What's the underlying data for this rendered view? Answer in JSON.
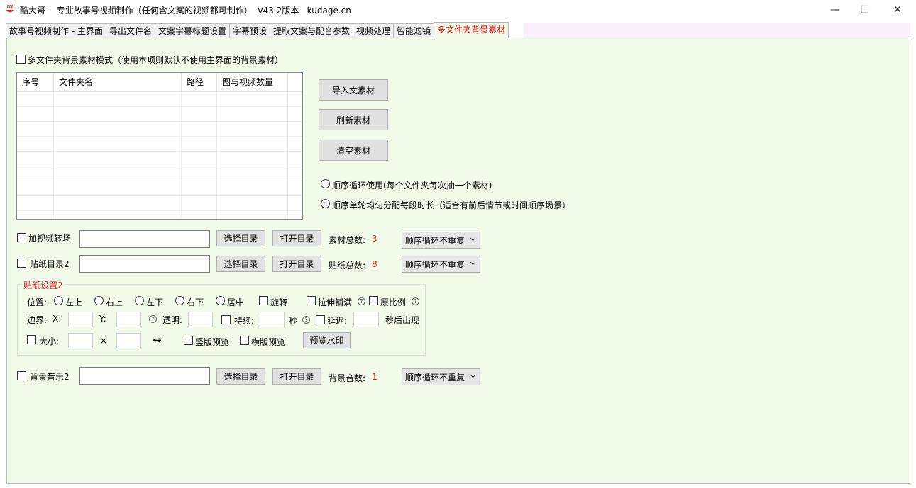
{
  "window": {
    "title": "酷大哥 -  专业故事号视频制作（任何含文案的视频都可制作）  v43.2版本   kudage.cn",
    "minimize": "—",
    "maximize": "☐",
    "close": "✕"
  },
  "tabs": [
    {
      "label": "故事号视频制作 - 主界面"
    },
    {
      "label": "导出文件名"
    },
    {
      "label": "文案字幕标题设置"
    },
    {
      "label": "字幕预设"
    },
    {
      "label": "提取文案与配音参数"
    },
    {
      "label": "视频处理"
    },
    {
      "label": "智能滤镜"
    },
    {
      "label": "多文件夹背景素材"
    }
  ],
  "mode_checkbox": {
    "label": "多文件夹背景素材模式（使用本项则默认不使用主界面的背景素材）",
    "checked": false
  },
  "table": {
    "columns": [
      "序号",
      "文件夹名",
      "路径",
      "图与视频数量"
    ],
    "rows": []
  },
  "side_buttons": {
    "import": "导入文素材",
    "refresh": "刷新素材",
    "clear": "清空素材"
  },
  "radios": {
    "sequential_loop": "顺序循环使用(每个文件夹每次抽一个素材)",
    "sequential_even": "顺序单轮均匀分配每段时长（适合有前后情节或时间顺序场景）"
  },
  "transition": {
    "checkbox_label": "加视频转场",
    "path_value": "",
    "select_dir": "选择目录",
    "open_dir": "打开目录",
    "count_label": "素材总数:",
    "count_value": "3",
    "mode": "顺序循环不重复"
  },
  "sticker": {
    "checkbox_label": "贴纸目录2",
    "path_value": "",
    "select_dir": "选择目录",
    "open_dir": "打开目录",
    "count_label": "贴纸总数:",
    "count_value": "8",
    "mode": "顺序循环不重复"
  },
  "sticker_settings": {
    "title": "贴纸设置2",
    "position_label": "位置:",
    "pos_top_left": "左上",
    "pos_top_right": "右上",
    "pos_bottom_left": "左下",
    "pos_bottom_right": "右下",
    "pos_center": "居中",
    "rotate": "旋转",
    "stretch": "拉伸铺满",
    "keep_ratio": "原比例",
    "border_label": "边界:",
    "x_label": "X:",
    "y_label": "Y:",
    "opacity_label": "透明:",
    "duration_label": "持续:",
    "seconds": "秒",
    "delay_label": "延迟:",
    "delay_suffix": "秒后出现",
    "size_label": "大小:",
    "times": "×",
    "swap_icon": "↔",
    "portrait_preview": "竖版预览",
    "landscape_preview": "横版预览",
    "preview_watermark": "预览水印",
    "help_glyph": "?"
  },
  "music": {
    "checkbox_label": "背景音乐2",
    "path_value": "",
    "select_dir": "选择目录",
    "open_dir": "打开目录",
    "count_label": "背景音数:",
    "count_value": "1",
    "mode": "顺序循环不重复"
  },
  "colors": {
    "panel_bg": "#f2fbea",
    "accent_red": "#e01818",
    "tab_strip_pink": "#fbeefb"
  }
}
